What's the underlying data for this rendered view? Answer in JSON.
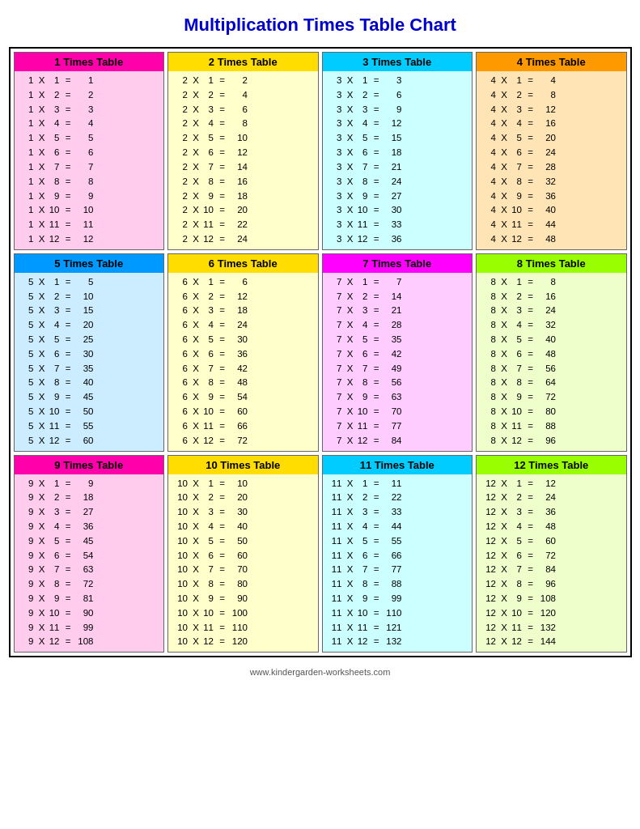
{
  "title": "Multiplication Times Table Chart",
  "footer": "www.kindergarden-worksheets.com",
  "tables": [
    {
      "id": 1,
      "label": "1 Times Table",
      "headerClass": "pink-header",
      "bodyClass": "pink-bg",
      "rows": [
        [
          1,
          "X",
          1,
          "=",
          1
        ],
        [
          1,
          "X",
          2,
          "=",
          2
        ],
        [
          1,
          "X",
          3,
          "=",
          3
        ],
        [
          1,
          "X",
          4,
          "=",
          4
        ],
        [
          1,
          "X",
          5,
          "=",
          5
        ],
        [
          1,
          "X",
          6,
          "=",
          6
        ],
        [
          1,
          "X",
          7,
          "=",
          7
        ],
        [
          1,
          "X",
          8,
          "=",
          8
        ],
        [
          1,
          "X",
          9,
          "=",
          9
        ],
        [
          1,
          "X",
          10,
          "=",
          10
        ],
        [
          1,
          "X",
          11,
          "=",
          11
        ],
        [
          1,
          "X",
          12,
          "=",
          12
        ]
      ]
    },
    {
      "id": 2,
      "label": "2 Times Table",
      "headerClass": "yellow-header",
      "bodyClass": "yellow-bg",
      "rows": [
        [
          2,
          "X",
          1,
          "=",
          2
        ],
        [
          2,
          "X",
          2,
          "=",
          4
        ],
        [
          2,
          "X",
          3,
          "=",
          6
        ],
        [
          2,
          "X",
          4,
          "=",
          8
        ],
        [
          2,
          "X",
          5,
          "=",
          10
        ],
        [
          2,
          "X",
          6,
          "=",
          12
        ],
        [
          2,
          "X",
          7,
          "=",
          14
        ],
        [
          2,
          "X",
          8,
          "=",
          16
        ],
        [
          2,
          "X",
          9,
          "=",
          18
        ],
        [
          2,
          "X",
          10,
          "=",
          20
        ],
        [
          2,
          "X",
          11,
          "=",
          22
        ],
        [
          2,
          "X",
          12,
          "=",
          24
        ]
      ]
    },
    {
      "id": 3,
      "label": "3 Times Table",
      "headerClass": "cyan-header",
      "bodyClass": "cyan-bg",
      "rows": [
        [
          3,
          "X",
          1,
          "=",
          3
        ],
        [
          3,
          "X",
          2,
          "=",
          6
        ],
        [
          3,
          "X",
          3,
          "=",
          9
        ],
        [
          3,
          "X",
          4,
          "=",
          12
        ],
        [
          3,
          "X",
          5,
          "=",
          15
        ],
        [
          3,
          "X",
          6,
          "=",
          18
        ],
        [
          3,
          "X",
          7,
          "=",
          21
        ],
        [
          3,
          "X",
          8,
          "=",
          24
        ],
        [
          3,
          "X",
          9,
          "=",
          27
        ],
        [
          3,
          "X",
          10,
          "=",
          30
        ],
        [
          3,
          "X",
          11,
          "=",
          33
        ],
        [
          3,
          "X",
          12,
          "=",
          36
        ]
      ]
    },
    {
      "id": 4,
      "label": "4 Times Table",
      "headerClass": "orange-header",
      "bodyClass": "orange-bg",
      "rows": [
        [
          4,
          "X",
          1,
          "=",
          4
        ],
        [
          4,
          "X",
          2,
          "=",
          8
        ],
        [
          4,
          "X",
          3,
          "=",
          12
        ],
        [
          4,
          "X",
          4,
          "=",
          16
        ],
        [
          4,
          "X",
          5,
          "=",
          20
        ],
        [
          4,
          "X",
          6,
          "=",
          24
        ],
        [
          4,
          "X",
          7,
          "=",
          28
        ],
        [
          4,
          "X",
          8,
          "=",
          32
        ],
        [
          4,
          "X",
          9,
          "=",
          36
        ],
        [
          4,
          "X",
          10,
          "=",
          40
        ],
        [
          4,
          "X",
          11,
          "=",
          44
        ],
        [
          4,
          "X",
          12,
          "=",
          48
        ]
      ]
    },
    {
      "id": 5,
      "label": "5 Times Table",
      "headerClass": "blue-header",
      "bodyClass": "blue-bg",
      "rows": [
        [
          5,
          "X",
          1,
          "=",
          5
        ],
        [
          5,
          "X",
          2,
          "=",
          10
        ],
        [
          5,
          "X",
          3,
          "=",
          15
        ],
        [
          5,
          "X",
          4,
          "=",
          20
        ],
        [
          5,
          "X",
          5,
          "=",
          25
        ],
        [
          5,
          "X",
          6,
          "=",
          30
        ],
        [
          5,
          "X",
          7,
          "=",
          35
        ],
        [
          5,
          "X",
          8,
          "=",
          40
        ],
        [
          5,
          "X",
          9,
          "=",
          45
        ],
        [
          5,
          "X",
          10,
          "=",
          50
        ],
        [
          5,
          "X",
          11,
          "=",
          55
        ],
        [
          5,
          "X",
          12,
          "=",
          60
        ]
      ]
    },
    {
      "id": 6,
      "label": "6 Times Table",
      "headerClass": "yellow-header",
      "bodyClass": "yellow-bg",
      "rows": [
        [
          6,
          "X",
          1,
          "=",
          6
        ],
        [
          6,
          "X",
          2,
          "=",
          12
        ],
        [
          6,
          "X",
          3,
          "=",
          18
        ],
        [
          6,
          "X",
          4,
          "=",
          24
        ],
        [
          6,
          "X",
          5,
          "=",
          30
        ],
        [
          6,
          "X",
          6,
          "=",
          36
        ],
        [
          6,
          "X",
          7,
          "=",
          42
        ],
        [
          6,
          "X",
          8,
          "=",
          48
        ],
        [
          6,
          "X",
          9,
          "=",
          54
        ],
        [
          6,
          "X",
          10,
          "=",
          60
        ],
        [
          6,
          "X",
          11,
          "=",
          66
        ],
        [
          6,
          "X",
          12,
          "=",
          72
        ]
      ]
    },
    {
      "id": 7,
      "label": "7 Times Table",
      "headerClass": "magenta-header",
      "bodyClass": "magenta-bg",
      "rows": [
        [
          7,
          "X",
          1,
          "=",
          7
        ],
        [
          7,
          "X",
          2,
          "=",
          14
        ],
        [
          7,
          "X",
          3,
          "=",
          21
        ],
        [
          7,
          "X",
          4,
          "=",
          28
        ],
        [
          7,
          "X",
          5,
          "=",
          35
        ],
        [
          7,
          "X",
          6,
          "=",
          42
        ],
        [
          7,
          "X",
          7,
          "=",
          49
        ],
        [
          7,
          "X",
          8,
          "=",
          56
        ],
        [
          7,
          "X",
          9,
          "=",
          63
        ],
        [
          7,
          "X",
          10,
          "=",
          70
        ],
        [
          7,
          "X",
          11,
          "=",
          77
        ],
        [
          7,
          "X",
          12,
          "=",
          84
        ]
      ]
    },
    {
      "id": 8,
      "label": "8 Times Table",
      "headerClass": "lime-header",
      "bodyClass": "lime-bg",
      "rows": [
        [
          8,
          "X",
          1,
          "=",
          8
        ],
        [
          8,
          "X",
          2,
          "=",
          16
        ],
        [
          8,
          "X",
          3,
          "=",
          24
        ],
        [
          8,
          "X",
          4,
          "=",
          32
        ],
        [
          8,
          "X",
          5,
          "=",
          40
        ],
        [
          8,
          "X",
          6,
          "=",
          48
        ],
        [
          8,
          "X",
          7,
          "=",
          56
        ],
        [
          8,
          "X",
          8,
          "=",
          64
        ],
        [
          8,
          "X",
          9,
          "=",
          72
        ],
        [
          8,
          "X",
          10,
          "=",
          80
        ],
        [
          8,
          "X",
          11,
          "=",
          88
        ],
        [
          8,
          "X",
          12,
          "=",
          96
        ]
      ]
    },
    {
      "id": 9,
      "label": "9 Times Table",
      "headerClass": "pink-header",
      "bodyClass": "pink-bg",
      "rows": [
        [
          9,
          "X",
          1,
          "=",
          9
        ],
        [
          9,
          "X",
          2,
          "=",
          18
        ],
        [
          9,
          "X",
          3,
          "=",
          27
        ],
        [
          9,
          "X",
          4,
          "=",
          36
        ],
        [
          9,
          "X",
          5,
          "=",
          45
        ],
        [
          9,
          "X",
          6,
          "=",
          54
        ],
        [
          9,
          "X",
          7,
          "=",
          63
        ],
        [
          9,
          "X",
          8,
          "=",
          72
        ],
        [
          9,
          "X",
          9,
          "=",
          81
        ],
        [
          9,
          "X",
          10,
          "=",
          90
        ],
        [
          9,
          "X",
          11,
          "=",
          99
        ],
        [
          9,
          "X",
          12,
          "=",
          108
        ]
      ]
    },
    {
      "id": 10,
      "label": "10 Times Table",
      "headerClass": "yellow-header",
      "bodyClass": "yellow-bg",
      "rows": [
        [
          10,
          "X",
          1,
          "=",
          10
        ],
        [
          10,
          "X",
          2,
          "=",
          20
        ],
        [
          10,
          "X",
          3,
          "=",
          30
        ],
        [
          10,
          "X",
          4,
          "=",
          40
        ],
        [
          10,
          "X",
          5,
          "=",
          50
        ],
        [
          10,
          "X",
          6,
          "=",
          60
        ],
        [
          10,
          "X",
          7,
          "=",
          70
        ],
        [
          10,
          "X",
          8,
          "=",
          80
        ],
        [
          10,
          "X",
          9,
          "=",
          90
        ],
        [
          10,
          "X",
          10,
          "=",
          100
        ],
        [
          10,
          "X",
          11,
          "=",
          110
        ],
        [
          10,
          "X",
          12,
          "=",
          120
        ]
      ]
    },
    {
      "id": 11,
      "label": "11 Times Table",
      "headerClass": "cyan-header",
      "bodyClass": "cyan-bg",
      "rows": [
        [
          11,
          "X",
          1,
          "=",
          11
        ],
        [
          11,
          "X",
          2,
          "=",
          22
        ],
        [
          11,
          "X",
          3,
          "=",
          33
        ],
        [
          11,
          "X",
          4,
          "=",
          44
        ],
        [
          11,
          "X",
          5,
          "=",
          55
        ],
        [
          11,
          "X",
          6,
          "=",
          66
        ],
        [
          11,
          "X",
          7,
          "=",
          77
        ],
        [
          11,
          "X",
          8,
          "=",
          88
        ],
        [
          11,
          "X",
          9,
          "=",
          99
        ],
        [
          11,
          "X",
          10,
          "=",
          110
        ],
        [
          11,
          "X",
          11,
          "=",
          121
        ],
        [
          11,
          "X",
          12,
          "=",
          132
        ]
      ]
    },
    {
      "id": 12,
      "label": "12 Times Table",
      "headerClass": "lime-header",
      "bodyClass": "lime-bg",
      "rows": [
        [
          12,
          "X",
          1,
          "=",
          12
        ],
        [
          12,
          "X",
          2,
          "=",
          24
        ],
        [
          12,
          "X",
          3,
          "=",
          36
        ],
        [
          12,
          "X",
          4,
          "=",
          48
        ],
        [
          12,
          "X",
          5,
          "=",
          60
        ],
        [
          12,
          "X",
          6,
          "=",
          72
        ],
        [
          12,
          "X",
          7,
          "=",
          84
        ],
        [
          12,
          "X",
          8,
          "=",
          96
        ],
        [
          12,
          "X",
          9,
          "=",
          108
        ],
        [
          12,
          "X",
          10,
          "=",
          120
        ],
        [
          12,
          "X",
          11,
          "=",
          132
        ],
        [
          12,
          "X",
          12,
          "=",
          144
        ]
      ]
    }
  ]
}
